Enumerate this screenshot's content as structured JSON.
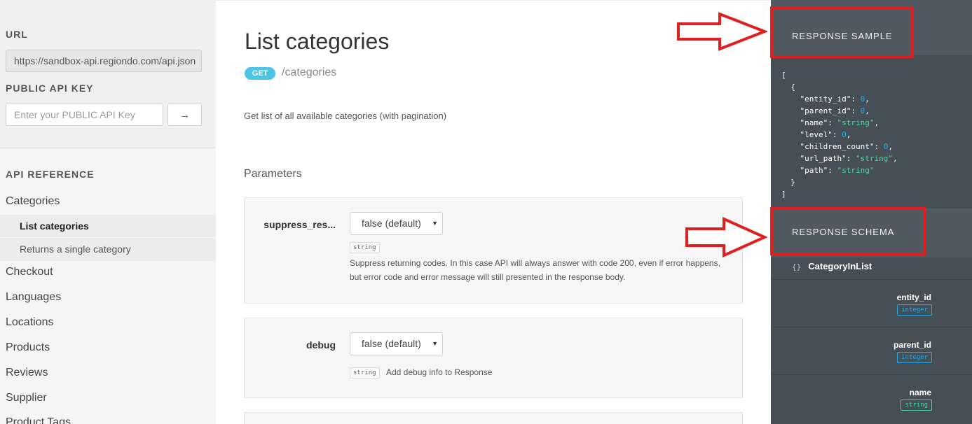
{
  "sidebar": {
    "url_heading": "URL",
    "url_value": "https://sandbox-api.regiondo.com/api.json",
    "key_heading": "PUBLIC API KEY",
    "key_placeholder": "Enter your PUBLIC API Key",
    "key_button_icon": "arrow-right-icon",
    "key_button_glyph": "→",
    "reference_heading": "API REFERENCE",
    "nav": [
      "Categories",
      "Checkout",
      "Languages",
      "Locations",
      "Products",
      "Reviews",
      "Supplier",
      "Product Tags"
    ],
    "sub_items": [
      "List categories",
      "Returns a single category"
    ],
    "active_sub_item": "List categories"
  },
  "main": {
    "title": "List categories",
    "method": "GET",
    "path": "/categories",
    "description": "Get list of all available categories (with pagination)",
    "parameters_heading": "Parameters",
    "params": [
      {
        "name": "suppress_res...",
        "selected": "false (default)",
        "type": "string",
        "description": "Suppress returning codes. In this case API will always answer with code 200, even if error happens, but error code and error message will still presented in the response body."
      },
      {
        "name": "debug",
        "selected": "false (default)",
        "type": "string",
        "description": "Add debug info to Response"
      }
    ]
  },
  "right": {
    "sample_heading": "RESPONSE SAMPLE",
    "schema_heading": "RESPONSE SCHEMA",
    "sample_lines": {
      "open_bracket": "[",
      "open_brace": "{",
      "entity_id": "0",
      "parent_id": "0",
      "name": "\"string\"",
      "level": "0",
      "children_count": "0",
      "url_path": "\"string\"",
      "path": "\"string\"",
      "close_brace": "}",
      "close_bracket": "]"
    },
    "schema_root": "CategoryInList",
    "schema_brace": "{}",
    "fields": [
      {
        "name": "entity_id",
        "type": "integer"
      },
      {
        "name": "parent_id",
        "type": "integer"
      },
      {
        "name": "name",
        "type": "string"
      }
    ]
  },
  "colors": {
    "get_badge": "#4dc3e8",
    "annotation_red": "#e02020",
    "number": "#26a9e0",
    "string": "#48d4a0",
    "right_panel": "#474f56"
  }
}
